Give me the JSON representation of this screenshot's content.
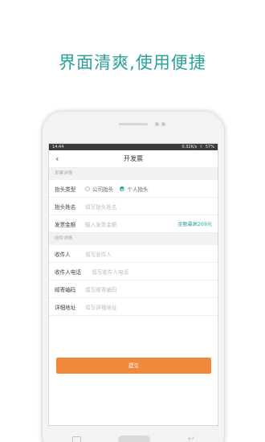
{
  "headline": "界面清爽,使用便捷",
  "status_bar": {
    "carrier": "14:44",
    "network": "0.32K/s",
    "battery": "57%"
  },
  "nav": {
    "back_icon": "chevron-left-icon",
    "title": "开发票"
  },
  "invoice_section": {
    "header": "发票详情",
    "title_type_label": "抬头类型",
    "option_company": "公司抬头",
    "option_personal": "个人抬头",
    "selected": "个人抬头",
    "title_name_label": "抬头姓名",
    "title_name_placeholder": "填写抬头姓名",
    "amount_label": "发票金额",
    "amount_placeholder": "输入发票金额",
    "amount_hint": "金额最高209元"
  },
  "recipient_section": {
    "header": "收件详情",
    "recipient_label": "收件人",
    "recipient_placeholder": "填写收件人",
    "phone_label": "收件人电话",
    "phone_placeholder": "填写收件人电话",
    "zip_label": "邮寄编码",
    "zip_placeholder": "填写邮寄编码",
    "address_label": "详细地址",
    "address_placeholder": "填写详细地址"
  },
  "submit_label": "提交",
  "colors": {
    "accent": "#2aa298",
    "submit": "#f08a3a"
  }
}
